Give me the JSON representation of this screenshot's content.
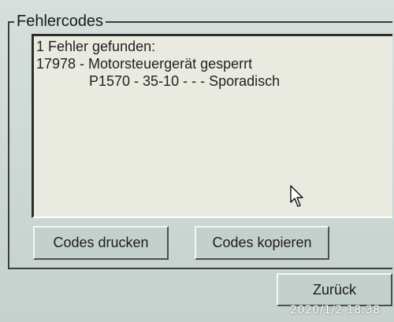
{
  "group": {
    "title": "Fehlercodes"
  },
  "output": {
    "line1": "1 Fehler gefunden:",
    "line2": "17978 - Motorsteuergerät gesperrt",
    "line3": "P1570 - 35-10 - - - Sporadisch"
  },
  "buttons": {
    "print_label": "Codes drucken",
    "copy_label": "Codes kopieren",
    "back_label": "Zurück"
  },
  "overlay": {
    "timestamp": "2020/1/2  18:38"
  },
  "icons": {
    "cursor": "mouse-pointer-icon"
  }
}
